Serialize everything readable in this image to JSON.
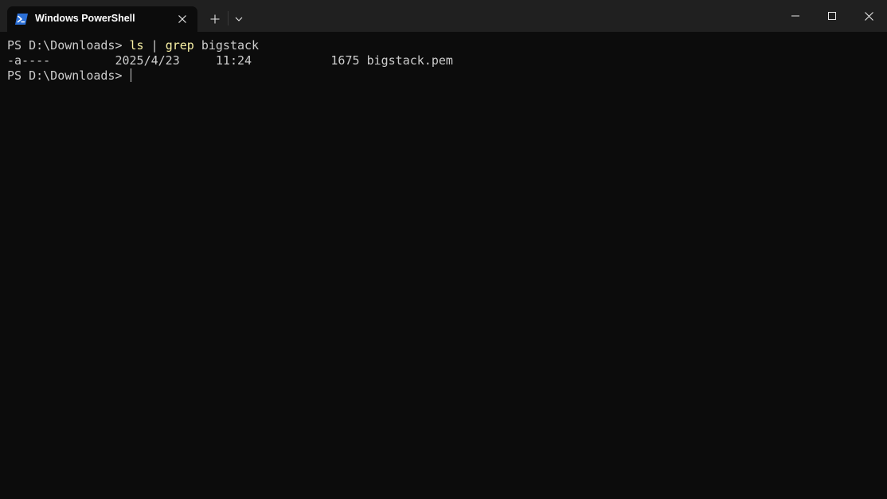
{
  "window": {
    "tab_title": "Windows PowerShell",
    "tab_icon": "powershell-icon",
    "colors": {
      "background": "#0c0c0c",
      "titlebar": "#202020",
      "text": "#cccccc",
      "command": "#f9f1a5"
    }
  },
  "terminal": {
    "line1": {
      "prompt": "PS D:\\Downloads> ",
      "cmd1": "ls",
      "pipe": " | ",
      "cmd2": "grep",
      "arg": " bigstack"
    },
    "line2": {
      "mode": "-a----",
      "date": "2025/4/23",
      "time": "11:24",
      "size": "1675",
      "name": "bigstack.pem"
    },
    "line3": {
      "prompt": "PS D:\\Downloads> "
    }
  }
}
